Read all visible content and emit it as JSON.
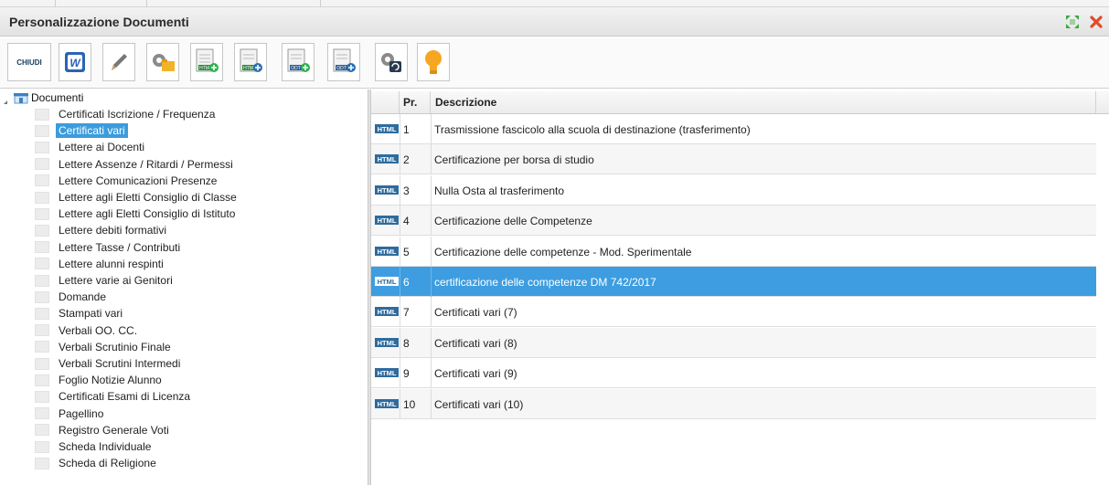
{
  "window": {
    "title": "Personalizzazione Documenti"
  },
  "toolbar": {
    "chiudi_label": "CHIUDI",
    "buttons": [
      {
        "name": "word-icon",
        "text": "W"
      },
      {
        "name": "edit-icon"
      },
      {
        "name": "gear-folder-icon"
      },
      {
        "name": "new-html-icon",
        "text": "HTM"
      },
      {
        "name": "add-html-icon",
        "text": "HTM"
      },
      {
        "name": "add-odt-icon",
        "text": "ODT"
      },
      {
        "name": "new-odt-icon",
        "text": "ODT"
      },
      {
        "name": "settings-refresh-icon"
      },
      {
        "name": "lightbulb-icon"
      }
    ]
  },
  "tree": {
    "root_label": "Documenti",
    "items": [
      "Certificati Iscrizione / Frequenza",
      "Certificati vari",
      "Lettere ai Docenti",
      "Lettere Assenze / Ritardi / Permessi",
      "Lettere Comunicazioni Presenze",
      "Lettere agli Eletti Consiglio di Classe",
      "Lettere agli Eletti Consiglio di Istituto",
      "Lettere debiti formativi",
      "Lettere Tasse / Contributi",
      "Lettere alunni respinti",
      "Lettere varie ai Genitori",
      "Domande",
      "Stampati vari",
      "Verbali OO. CC.",
      "Verbali Scrutinio Finale",
      "Verbali Scrutini Intermedi",
      "Foglio Notizie Alunno",
      "Certificati Esami di Licenza",
      "Pagellino",
      "Registro Generale Voti",
      "Scheda Individuale",
      "Scheda di Religione"
    ],
    "selected_index": 1
  },
  "grid": {
    "headers": {
      "pr": "Pr.",
      "descrizione": "Descrizione"
    },
    "rows": [
      {
        "type": "HTML",
        "pr": "1",
        "desc": "Trasmissione fascicolo alla scuola di destinazione (trasferimento)"
      },
      {
        "type": "HTML",
        "pr": "2",
        "desc": "Certificazione per borsa di studio"
      },
      {
        "type": "HTML",
        "pr": "3",
        "desc": "Nulla Osta al trasferimento"
      },
      {
        "type": "HTML",
        "pr": "4",
        "desc": "Certificazione delle Competenze"
      },
      {
        "type": "HTML",
        "pr": "5",
        "desc": "Certificazione delle competenze - Mod. Sperimentale"
      },
      {
        "type": "HTML",
        "pr": "6",
        "desc": "certificazione delle competenze DM 742/2017"
      },
      {
        "type": "HTML",
        "pr": "7",
        "desc": "Certificati vari (7)"
      },
      {
        "type": "HTML",
        "pr": "8",
        "desc": "Certificati vari (8)"
      },
      {
        "type": "HTML",
        "pr": "9",
        "desc": "Certificati vari (9)"
      },
      {
        "type": "HTML",
        "pr": "10",
        "desc": "Certificati vari (10)"
      }
    ],
    "selected_index": 5
  },
  "colors": {
    "selection": "#3d9de0",
    "close": "#e04a2b",
    "expand": "#3ea64a",
    "html_badge": "#2e6b9e"
  }
}
